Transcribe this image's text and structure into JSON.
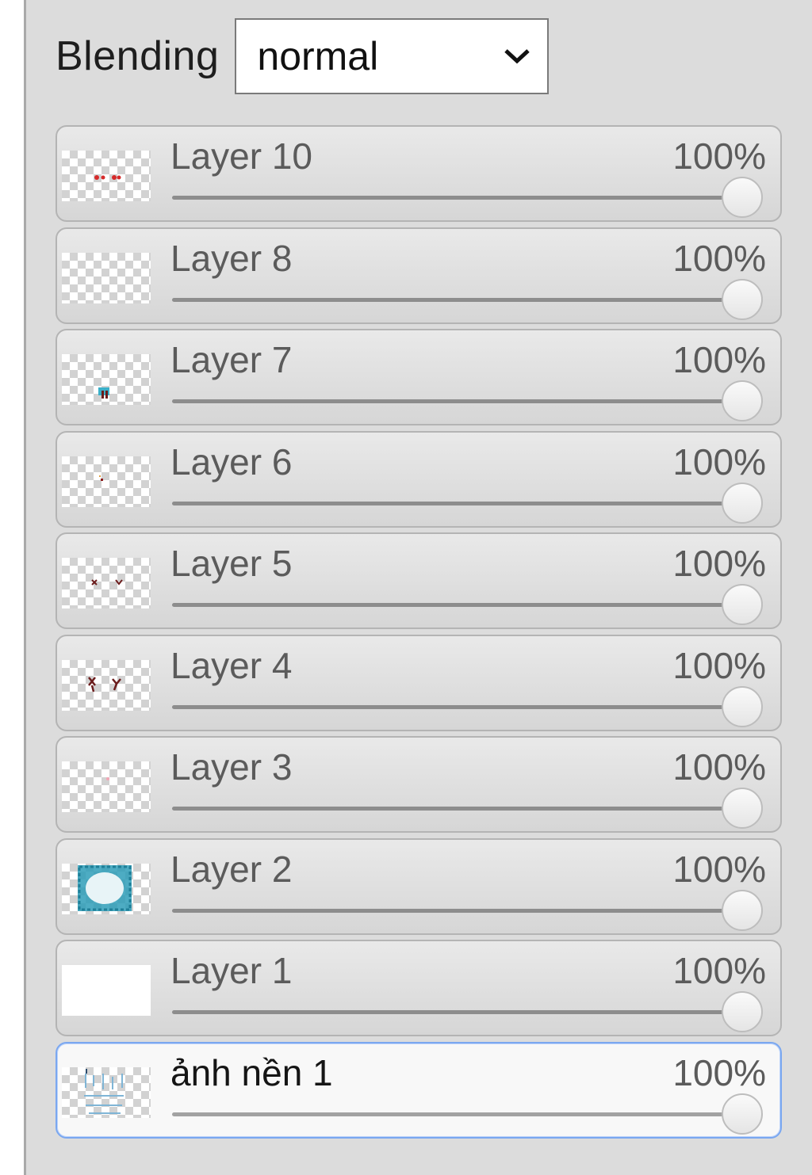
{
  "blending": {
    "label": "Blending",
    "selected": "normal"
  },
  "layers": [
    {
      "name": "Layer 10",
      "opacity": "100%",
      "opacity_value": 1.0,
      "thumb": "red-dots"
    },
    {
      "name": "Layer 8",
      "opacity": "100%",
      "opacity_value": 1.0,
      "thumb": "empty"
    },
    {
      "name": "Layer 7",
      "opacity": "100%",
      "opacity_value": 1.0,
      "thumb": "small-figure"
    },
    {
      "name": "Layer 6",
      "opacity": "100%",
      "opacity_value": 1.0,
      "thumb": "tiny-mark"
    },
    {
      "name": "Layer 5",
      "opacity": "100%",
      "opacity_value": 1.0,
      "thumb": "eyes"
    },
    {
      "name": "Layer 4",
      "opacity": "100%",
      "opacity_value": 1.0,
      "thumb": "face-marks"
    },
    {
      "name": "Layer 3",
      "opacity": "100%",
      "opacity_value": 1.0,
      "thumb": "faint-pink"
    },
    {
      "name": "Layer 2",
      "opacity": "100%",
      "opacity_value": 1.0,
      "thumb": "teal-frame"
    },
    {
      "name": "Layer 1",
      "opacity": "100%",
      "opacity_value": 1.0,
      "thumb": "white-fill"
    },
    {
      "name": "ảnh nền 1",
      "opacity": "100%",
      "opacity_value": 1.0,
      "thumb": "background-pattern",
      "active": true
    }
  ],
  "colors": {
    "panel_bg": "#dcdcdc",
    "active_border": "#7aa7f0",
    "thumb_red": "#d62a2a",
    "thumb_teal": "#2e9db8",
    "thumb_dark": "#6b1c1c"
  }
}
